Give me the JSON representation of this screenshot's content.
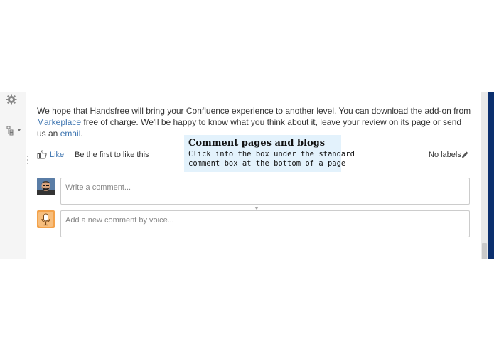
{
  "page": {
    "paragraph": {
      "part1": "We hope that Handsfree will bring your Confluence experience to another level. You can download the add-on from ",
      "marketplace_link": "Markeplace",
      "part2": " free of charge. We'll be happy to know what you think about it, leave your review on its page or send us an ",
      "email_link": "email",
      "part3": "."
    },
    "like_label": "Like",
    "like_first": "Be the first to like this",
    "labels_text": "No labels"
  },
  "tooltip": {
    "title": "Comment pages and blogs",
    "line1": "Click into the box under the standard",
    "line2": "comment box at the bottom of a page"
  },
  "comments": {
    "write_placeholder": "Write a comment...",
    "voice_placeholder": "Add a new comment by voice..."
  },
  "colors": {
    "link": "#3b73af",
    "tooltip_bg": "#e3f2fc",
    "accent_dark": "#0b2f6e",
    "voice_avatar": "#f3a24b"
  },
  "icons": [
    "gear-icon",
    "page-tree-icon",
    "drag-handle-icon",
    "thumbs-up-icon",
    "pencil-icon",
    "user-avatar",
    "microphone-icon"
  ]
}
